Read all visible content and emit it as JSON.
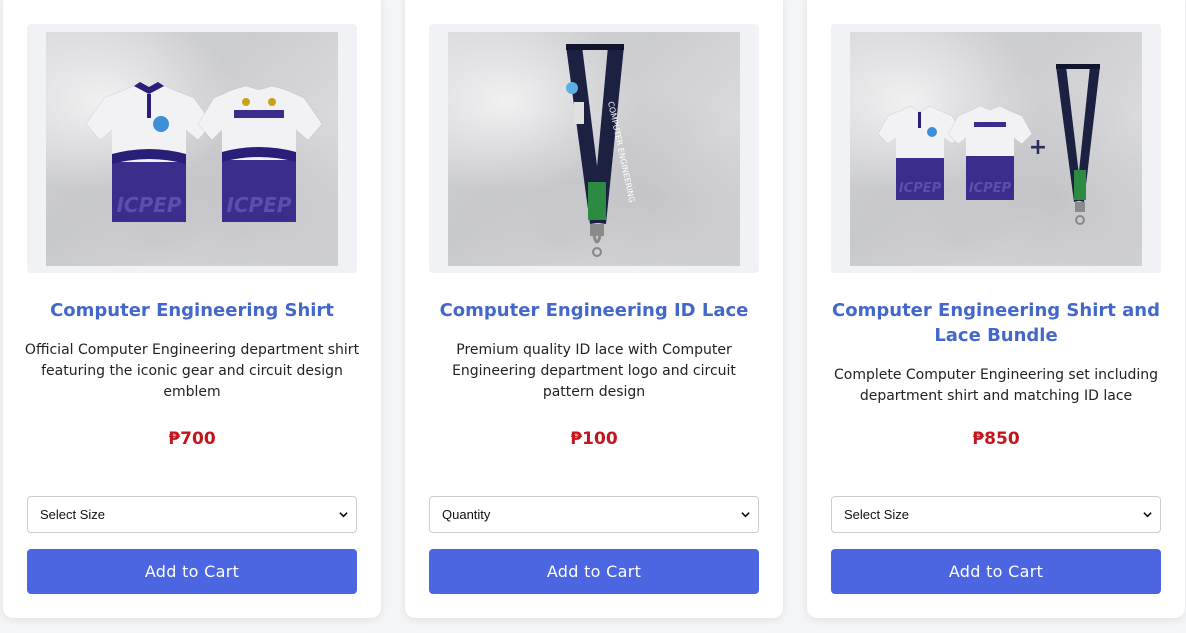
{
  "currency_symbol": "₱",
  "accent_color": "#4468c9",
  "button_color": "#4b66e0",
  "price_color": "#c3151b",
  "products": [
    {
      "title": "Computer Engineering Shirt",
      "description": "Official Computer Engineering department shirt featuring the iconic gear and circuit design emblem",
      "price": "₱700",
      "select_value": "Select Size",
      "button_label": "Add to Cart",
      "image_icon": "polo-shirts-image"
    },
    {
      "title": "Computer Engineering ID Lace",
      "description": "Premium quality ID lace with Computer Engineering department logo and circuit pattern design",
      "price": "₱100",
      "select_value": "Quantity",
      "button_label": "Add to Cart",
      "image_icon": "lanyard-image"
    },
    {
      "title": "Computer Engineering Shirt and Lace Bundle",
      "description": "Complete Computer Engineering set including department shirt and matching ID lace",
      "price": "₱850",
      "select_value": "Select Size",
      "button_label": "Add to Cart",
      "image_icon": "shirt-lanyard-bundle-image"
    }
  ]
}
